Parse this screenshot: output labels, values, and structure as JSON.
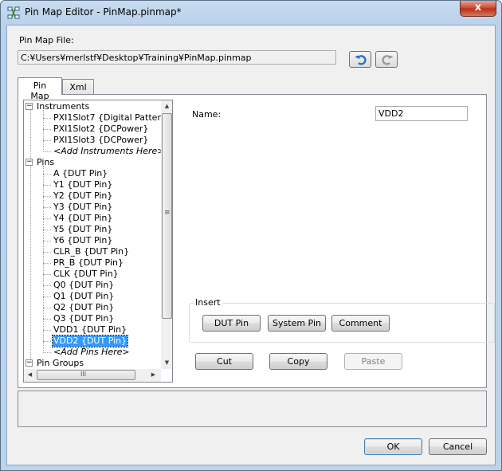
{
  "window": {
    "title": "Pin Map Editor - PinMap.pinmap*",
    "close_label": "x"
  },
  "file": {
    "label": "Pin Map File:",
    "path": "C:¥Users¥merlstf¥Desktop¥Training¥PinMap.pinmap"
  },
  "tabs": [
    {
      "label": "Pin Map",
      "active": true
    },
    {
      "label": "Xml",
      "active": false
    }
  ],
  "tree": {
    "instruments_label": "Instruments",
    "instruments": [
      "PXI1Slot7 {Digital Patter",
      "PXI1Slot2 {DCPower}",
      "PXI1Slot3 {DCPower}"
    ],
    "add_instruments": "<Add Instruments Here>",
    "pins_label": "Pins",
    "pins": [
      "A {DUT Pin}",
      "Y1 {DUT Pin}",
      "Y2 {DUT Pin}",
      "Y3 {DUT Pin}",
      "Y4 {DUT Pin}",
      "Y5 {DUT Pin}",
      "Y6 {DUT Pin}",
      "CLR_B {DUT Pin}",
      "PR_B {DUT Pin}",
      "CLK {DUT Pin}",
      "Q0 {DUT Pin}",
      "Q1 {DUT Pin}",
      "Q2 {DUT Pin}",
      "Q3 {DUT Pin}",
      "VDD1 {DUT Pin}",
      "VDD2 {DUT Pin}"
    ],
    "selected_pin": "VDD2 {DUT Pin}",
    "add_pins": "<Add Pins Here>",
    "pin_groups_label": "Pin Groups",
    "expander_symbol": "−",
    "grip_symbol": "≡",
    "hgrip_symbol": "III"
  },
  "details": {
    "name_label": "Name:",
    "name_value": "VDD2"
  },
  "insert": {
    "legend": "Insert",
    "dut_pin": "DUT Pin",
    "system_pin": "System Pin",
    "comment": "Comment"
  },
  "edit": {
    "cut": "Cut",
    "copy": "Copy",
    "paste": "Paste"
  },
  "dialog": {
    "ok": "OK",
    "cancel": "Cancel"
  },
  "colors": {
    "selection": "#3399ff",
    "undo_icon": "#2a6fc9",
    "redo_icon": "#9a9a9a"
  }
}
